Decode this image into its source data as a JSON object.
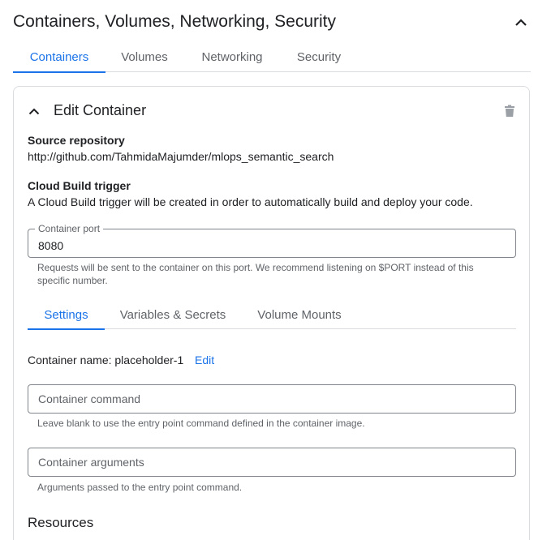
{
  "section": {
    "title": "Containers, Volumes, Networking, Security"
  },
  "top_tabs": [
    {
      "label": "Containers",
      "active": true
    },
    {
      "label": "Volumes",
      "active": false
    },
    {
      "label": "Networking",
      "active": false
    },
    {
      "label": "Security",
      "active": false
    }
  ],
  "card": {
    "title": "Edit Container",
    "source_repo_label": "Source repository",
    "source_repo_value": "http://github.com/TahmidaMajumder/mlops_semantic_search",
    "trigger_label": "Cloud Build trigger",
    "trigger_text": "A Cloud Build trigger will be created in order to automatically build and deploy your code.",
    "port": {
      "label": "Container port",
      "value": "8080",
      "helper": "Requests will be sent to the container on this port. We recommend listening on $PORT instead of this specific number."
    },
    "inner_tabs": [
      {
        "label": "Settings",
        "active": true
      },
      {
        "label": "Variables & Secrets",
        "active": false
      },
      {
        "label": "Volume Mounts",
        "active": false
      }
    ],
    "container_name_text": "Container name: placeholder-1",
    "edit_label": "Edit",
    "command": {
      "placeholder": "Container command",
      "helper": "Leave blank to use the entry point command defined in the container image."
    },
    "arguments": {
      "placeholder": "Container arguments",
      "helper": "Arguments passed to the entry point command."
    },
    "resources_heading": "Resources"
  },
  "icons": {
    "collapse": "chevron-up-icon",
    "card_toggle": "chevron-up-icon",
    "delete": "trash-icon"
  },
  "colors": {
    "accent": "#1a73e8",
    "text": "#202124",
    "secondary_text": "#5f6368",
    "border": "#dadce0"
  }
}
